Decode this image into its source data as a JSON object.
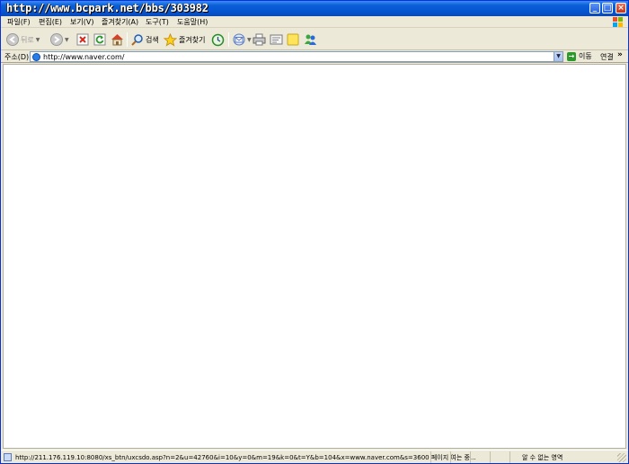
{
  "window": {
    "title": "http://www.bcpark.net/bbs/303982"
  },
  "menubar": {
    "items": [
      "파일(F)",
      "편집(E)",
      "보기(V)",
      "즐겨찾기(A)",
      "도구(T)",
      "도움말(H)"
    ]
  },
  "toolbar": {
    "back_label": "뒤로",
    "search_label": "검색",
    "favorites_label": "즐겨찾기"
  },
  "address": {
    "label": "주소(D)",
    "url": "http://www.naver.com/",
    "go_label": "이동",
    "links_label": "연결",
    "links_more": "»"
  },
  "status": {
    "text": "http://211.176.119.10:8080/xs_btn/uxcsdo.asp?n=2&u=42760&i=10&y=0&m=19&k=0&t=Y&b=104&x=www.naver.com&s=3600 페이지 여는 중...",
    "zone": "알 수 없는 영역"
  },
  "colors": {
    "titlebar": "#0554d0",
    "chrome": "#ece9d8",
    "content": "#ffffff"
  }
}
